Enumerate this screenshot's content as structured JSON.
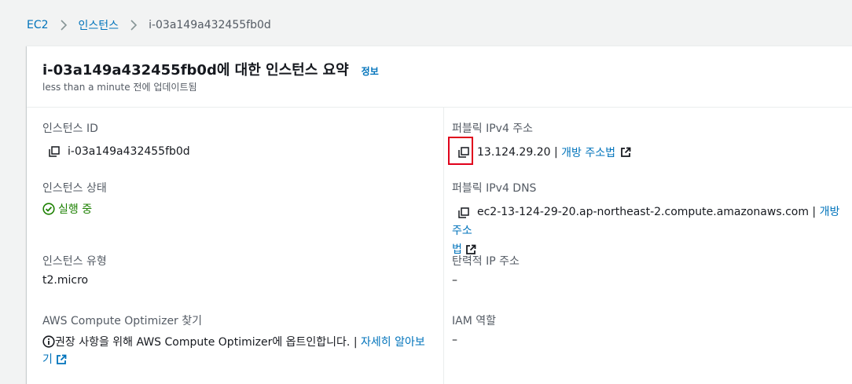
{
  "breadcrumb": {
    "items": [
      "EC2",
      "인스턴스"
    ],
    "current": "i-03a149a432455fb0d"
  },
  "summary": {
    "title": "i-03a149a432455fb0d에 대한 인스턴스 요약",
    "info_link": "정보",
    "updated": "less than a minute 전에 업데이트됨"
  },
  "fields": {
    "instance_id": {
      "label": "인스턴스 ID",
      "value": "i-03a149a432455fb0d"
    },
    "public_ipv4": {
      "label": "퍼블릭 IPv4 주소",
      "value": "13.124.29.20",
      "separator": " | ",
      "link": "개방 주소법"
    },
    "instance_state": {
      "label": "인스턴스 상태",
      "value": "실행 중"
    },
    "public_dns": {
      "label": "퍼블릭 IPv4 DNS",
      "value": "ec2-13-124-29-20.ap-northeast-2.compute.amazonaws.com",
      "separator": " | ",
      "link_part1": "개방 주소",
      "link_part2": "법"
    },
    "instance_type": {
      "label": "인스턴스 유형",
      "value": "t2.micro"
    },
    "elastic_ip": {
      "label": "탄력적 IP 주소",
      "value": "–"
    },
    "optimizer": {
      "label": "AWS Compute Optimizer 찾기",
      "text": "권장 사항을 위해 AWS Compute Optimizer에 옵트인합니다.",
      "separator": " | ",
      "link_part1": "자세히 알아보",
      "link_part2": "기"
    },
    "iam_role": {
      "label": "IAM 역할",
      "value": "–"
    }
  },
  "colors": {
    "link": "#0073bb",
    "running": "#1d8102",
    "highlight": "#e0001b"
  }
}
